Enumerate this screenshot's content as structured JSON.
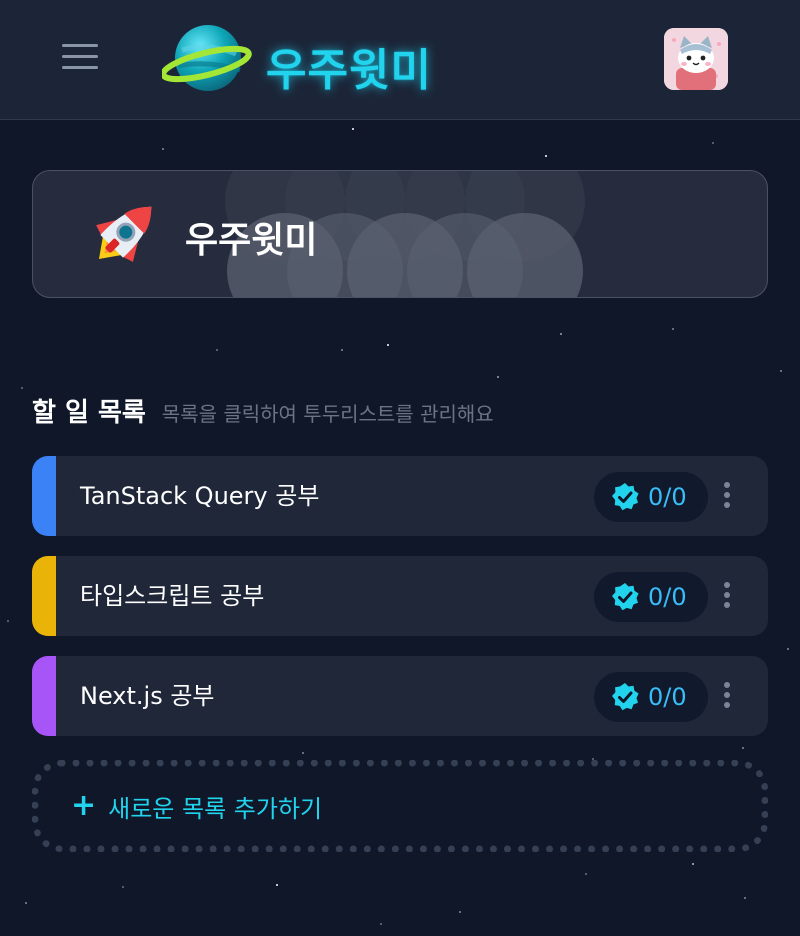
{
  "header": {
    "logo_text": "우주윗미",
    "menu_icon": "hamburger-icon",
    "logo_icon": "saturn-planet-icon",
    "avatar_icon": "cat-avatar-icon"
  },
  "banner": {
    "title": "우주윗미",
    "icon": "rocket-icon"
  },
  "section": {
    "title": "할 일 목록",
    "subtitle": "목록을 클릭하여 투두리스트를 관리해요"
  },
  "lists": [
    {
      "name": "TanStack Query 공부",
      "count": "0/0",
      "color": "#3b82f6"
    },
    {
      "name": "타입스크립트 공부",
      "count": "0/0",
      "color": "#eab308"
    },
    {
      "name": "Next.js 공부",
      "count": "0/0",
      "color": "#a855f7"
    }
  ],
  "add_new": {
    "label": "새로운 목록 추가하기",
    "icon": "plus-icon"
  },
  "colors": {
    "accent": "#22d3ee",
    "background": "#0f1729",
    "header": "#1c2538",
    "card": "#1f2739",
    "badge": "#111a2c"
  }
}
